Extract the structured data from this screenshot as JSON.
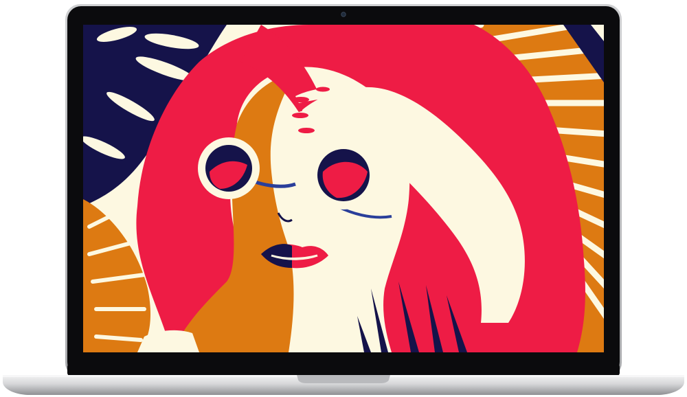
{
  "device": {
    "type": "laptop",
    "bezel_color": "#0b0b0d",
    "chassis_color": "#d9dadc",
    "camera_icon": "camera-dot-icon"
  },
  "wallpaper": {
    "palette": {
      "cream": "#fdf8e1",
      "pink": "#ee1c45",
      "orange": "#dd7a12",
      "navy": "#15134a",
      "blue_glasses": "#2a3f9a"
    },
    "icons": [
      "woman-portrait-illustration",
      "sunglasses-icon",
      "palm-leaf-icon",
      "hand-icon"
    ]
  }
}
